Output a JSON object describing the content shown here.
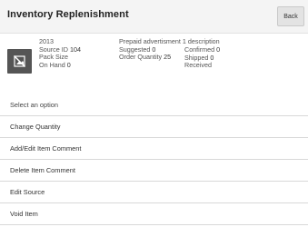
{
  "header": {
    "title": "Inventory Replenishment",
    "back_label": "Back"
  },
  "item": {
    "number": "2013",
    "source_id_label": "Source ID",
    "source_id_value": "104",
    "pack_size_label": "Pack Size",
    "on_hand_label": "On Hand",
    "on_hand_value": "0",
    "description": "Prepaid advertisment 1 description",
    "suggested_label": "Suggested",
    "suggested_value": "0",
    "order_qty_label": "Order Quantity",
    "order_qty_value": "25",
    "confirmed_label": "Confirmed",
    "confirmed_value": "0",
    "shipped_label": "Shipped",
    "shipped_value": "0",
    "received_label": "Received"
  },
  "menu": {
    "header": "Select an option",
    "items": [
      {
        "label": "Change Quantity"
      },
      {
        "label": "Add/Edit Item Comment"
      },
      {
        "label": "Delete Item Comment"
      },
      {
        "label": "Edit Source"
      },
      {
        "label": "Void Item"
      }
    ]
  }
}
